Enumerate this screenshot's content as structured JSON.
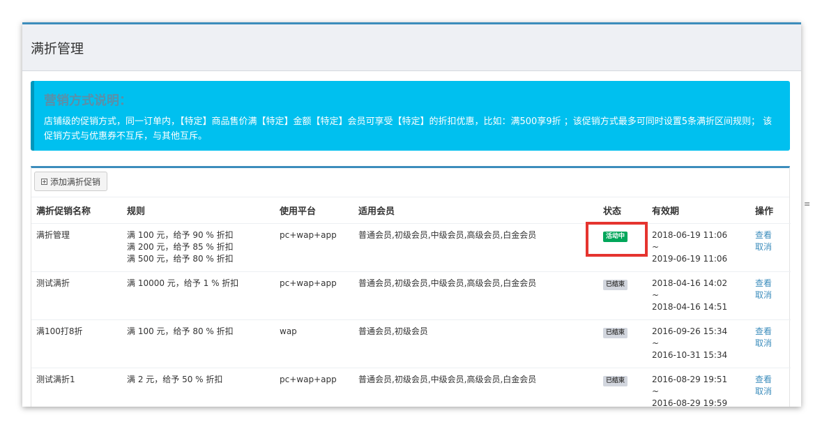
{
  "page": {
    "title": "满折管理"
  },
  "info": {
    "title": "营销方式说明：",
    "text": "店铺级的促销方式，同一订单内，【特定】商品售价满【特定】金额【特定】会员可享受【特定】的折扣优惠，比如：满500享9折 ；该促销方式最多可同时设置5条满折区间规则； 该促销方式与优惠券不互斥，与其他互斥。"
  },
  "toolbar": {
    "add_label": "添加满折促销"
  },
  "table": {
    "headers": {
      "name": "满折促销名称",
      "rule": "规则",
      "platform": "使用平台",
      "members": "适用会员",
      "status": "状态",
      "validity": "有效期",
      "actions": "操作"
    },
    "rows": [
      {
        "name": "满折管理",
        "rules": [
          "满 100 元，给予 90 % 折扣",
          "满 200 元，给予 85 % 折扣",
          "满 500 元，给予 80 % 折扣"
        ],
        "platform": "pc+wap+app",
        "members": "普通会员,初级会员,中级会员,高级会员,白金会员",
        "status": "活动中",
        "status_type": "active",
        "start": "2018-06-19 11:06",
        "sep": "~",
        "end": "2019-06-19 11:06",
        "view": "查看",
        "cancel": "取消"
      },
      {
        "name": "测试满折",
        "rules": [
          "满 10000 元，给予 1 % 折扣"
        ],
        "platform": "pc+wap+app",
        "members": "普通会员,初级会员,中级会员,高级会员,白金会员",
        "status": "已结束",
        "status_type": "ended",
        "start": "2018-04-16 14:02",
        "sep": "~",
        "end": "2018-04-16 14:51",
        "view": "查看",
        "cancel": "取消"
      },
      {
        "name": "满100打8折",
        "rules": [
          "满 100 元，给予 80 % 折扣"
        ],
        "platform": "wap",
        "members": "普通会员,初级会员",
        "status": "已结束",
        "status_type": "ended",
        "start": "2016-09-26 15:34",
        "sep": "~",
        "end": "2016-10-31 15:34",
        "view": "查看",
        "cancel": "取消"
      },
      {
        "name": "测试满折1",
        "rules": [
          "满 2 元，给予 50 % 折扣"
        ],
        "platform": "pc+wap+app",
        "members": "普通会员,初级会员,中级会员,高级会员,白金会员",
        "status": "已结束",
        "status_type": "ended",
        "start": "2016-08-29 19:51",
        "sep": "~",
        "end": "2016-08-29 19:59",
        "view": "查看",
        "cancel": "取消"
      }
    ]
  },
  "colors": {
    "accent": "#3c8dbc",
    "info_bg": "#00c0ef",
    "active": "#00a65a",
    "ended": "#d2d6de",
    "highlight": "#e5342f"
  }
}
